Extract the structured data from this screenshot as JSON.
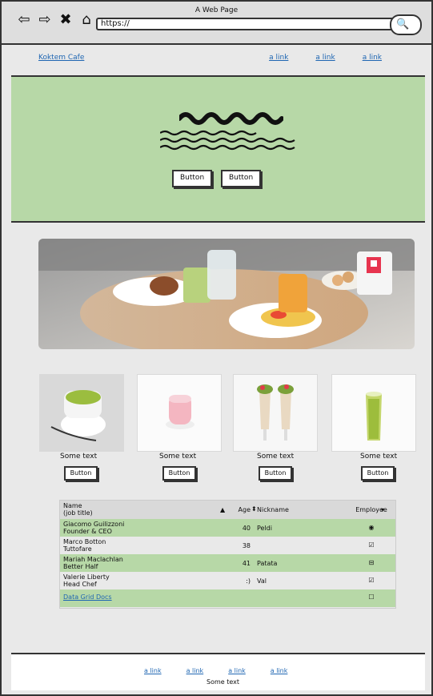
{
  "window": {
    "title": "A Web Page"
  },
  "browser": {
    "url": "https://",
    "icons": [
      "back-icon",
      "forward-icon",
      "close-icon",
      "home-icon",
      "search-icon"
    ]
  },
  "header": {
    "brand": "Koktem Cafe",
    "links": [
      "a link",
      "a link",
      "a link"
    ]
  },
  "hero": {
    "buttons": [
      "Button",
      "Button"
    ]
  },
  "cards": [
    {
      "caption": "Some text",
      "button": "Button"
    },
    {
      "caption": "Some text",
      "button": "Button"
    },
    {
      "caption": "Some text",
      "button": "Button"
    },
    {
      "caption": "Some text",
      "button": "Button"
    }
  ],
  "grid": {
    "headers": {
      "name": "Name\n(job title)",
      "age": "Age",
      "nickname": "Nickname",
      "employee": "Employee"
    },
    "rows": [
      {
        "name": "Giacomo Guilizzoni\nFounder & CEO",
        "age": "40",
        "nickname": "Peldi",
        "employee": "◉"
      },
      {
        "name": "Marco Botton\nTuttofare",
        "age": "38",
        "nickname": "",
        "employee": "☑"
      },
      {
        "name": "Mariah Maclachlan\nBetter Half",
        "age": "41",
        "nickname": "Patata",
        "employee": "⊟"
      },
      {
        "name": "Valerie Liberty\nHead Chef",
        "age": ":)",
        "nickname": "Val",
        "employee": "☑"
      },
      {
        "name": "Data Grid Docs",
        "age": "",
        "nickname": "",
        "employee": "☐"
      }
    ]
  },
  "footer": {
    "links": [
      "a link",
      "a link",
      "a link",
      "a link"
    ],
    "text": "Some text"
  }
}
